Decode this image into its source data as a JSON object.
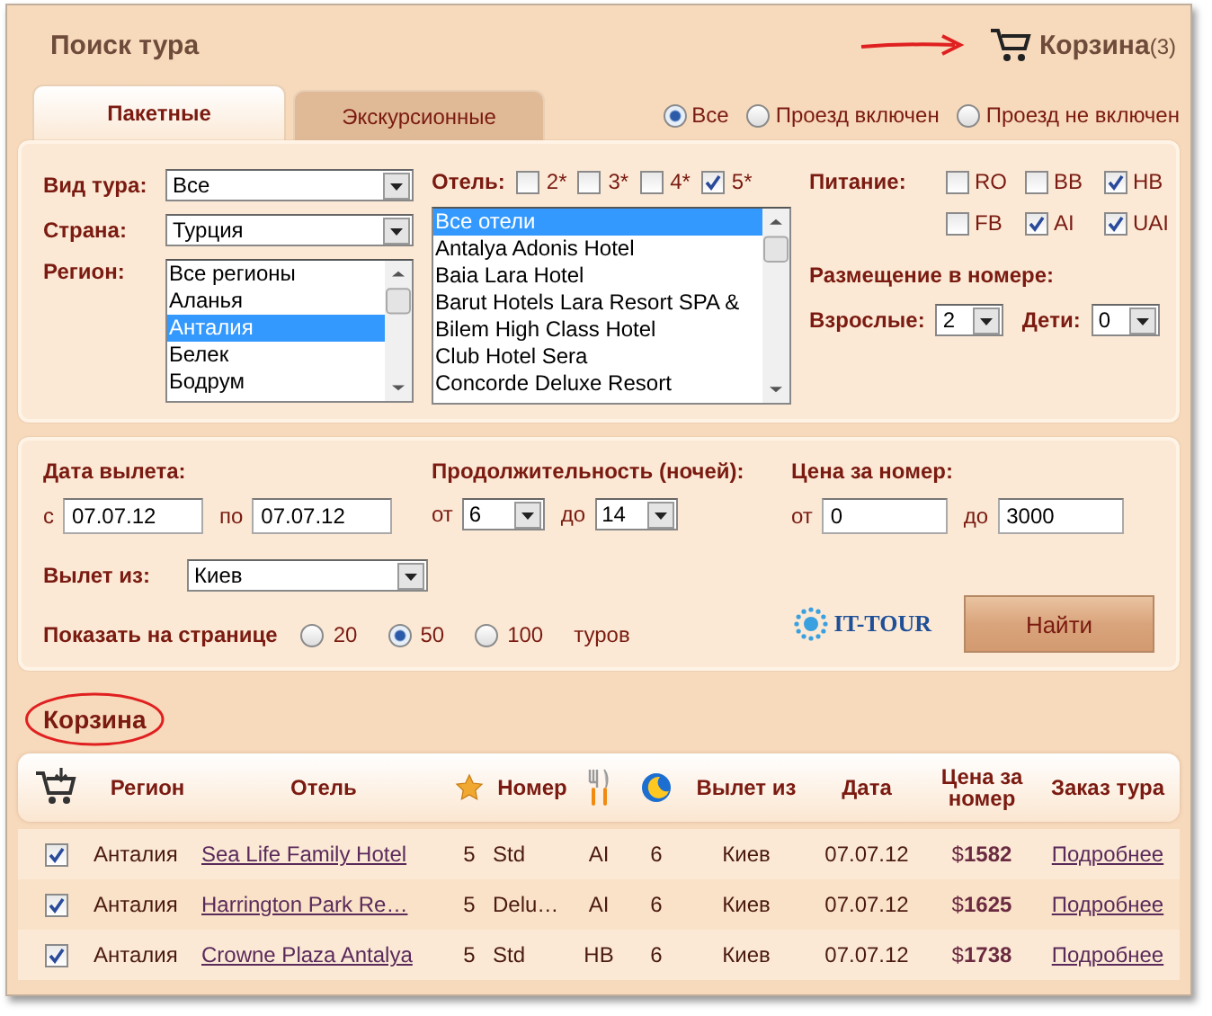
{
  "title": "Поиск тура",
  "cart": {
    "label": "Корзина",
    "count": "(3)"
  },
  "tabs": [
    {
      "label": "Пакетные",
      "selected": true
    },
    {
      "label": "Экскурсионные",
      "selected": false
    }
  ],
  "travel_filter": [
    {
      "label": "Все",
      "selected": true
    },
    {
      "label": "Проезд включен",
      "selected": false
    },
    {
      "label": "Проезд не включен",
      "selected": false
    }
  ],
  "tour_type": {
    "label": "Вид тура:",
    "value": "Все"
  },
  "country": {
    "label": "Страна:",
    "value": "Турция"
  },
  "region": {
    "label": "Регион:",
    "items": [
      {
        "label": "Все регионы",
        "selected": false
      },
      {
        "label": "Аланья",
        "selected": false
      },
      {
        "label": "Анталия",
        "selected": true
      },
      {
        "label": "Белек",
        "selected": false
      },
      {
        "label": "Бодрум",
        "selected": false
      }
    ]
  },
  "hotel": {
    "label": "Отель:",
    "stars": [
      {
        "label": "2*",
        "checked": false
      },
      {
        "label": "3*",
        "checked": false
      },
      {
        "label": "4*",
        "checked": false
      },
      {
        "label": "5*",
        "checked": true
      }
    ],
    "items": [
      {
        "label": "Все отели",
        "selected": true
      },
      {
        "label": "Antalya Adonis Hotel",
        "selected": false
      },
      {
        "label": "Baia Lara Hotel",
        "selected": false
      },
      {
        "label": "Barut Hotels Lara Resort SPA &",
        "selected": false
      },
      {
        "label": "Bilem High Class Hotel",
        "selected": false
      },
      {
        "label": "Club Hotel Sera",
        "selected": false
      },
      {
        "label": "Concorde Deluxe Resort",
        "selected": false
      }
    ]
  },
  "meal": {
    "label": "Питание:",
    "options": [
      {
        "label": "RO",
        "checked": false
      },
      {
        "label": "BB",
        "checked": false
      },
      {
        "label": "HB",
        "checked": true
      },
      {
        "label": "FB",
        "checked": false
      },
      {
        "label": "AI",
        "checked": true
      },
      {
        "label": "UAI",
        "checked": true
      }
    ]
  },
  "accommodation": {
    "label": "Размещение в номере:",
    "adults": {
      "label": "Взрослые:",
      "value": "2"
    },
    "children": {
      "label": "Дети:",
      "value": "0"
    }
  },
  "dates": {
    "label": "Дата вылета:",
    "from_label": "с",
    "from": "07.07.12",
    "to_label": "по",
    "to": "07.07.12"
  },
  "duration": {
    "label": "Продолжительность (ночей):",
    "from_label": "от",
    "from": "6",
    "to_label": "до",
    "to": "14"
  },
  "price": {
    "label": "Цена за номер:",
    "from_label": "от",
    "from": "0",
    "to_label": "до",
    "to": "3000"
  },
  "departure": {
    "label": "Вылет из:",
    "value": "Киев"
  },
  "per_page": {
    "label": "Показать на странице",
    "options": [
      {
        "label": "20",
        "selected": false
      },
      {
        "label": "50",
        "selected": true
      },
      {
        "label": "100",
        "selected": false
      }
    ],
    "suffix": "туров"
  },
  "logo": "IT-TOUR",
  "search_button": "Найти",
  "basket": {
    "heading": "Корзина",
    "columns": [
      {
        "kind": "cart"
      },
      {
        "kind": "text",
        "label": "Регион"
      },
      {
        "kind": "text",
        "label": "Отель"
      },
      {
        "kind": "star"
      },
      {
        "kind": "text",
        "label": "Номер"
      },
      {
        "kind": "meal"
      },
      {
        "kind": "nights"
      },
      {
        "kind": "text",
        "label": "Вылет из"
      },
      {
        "kind": "text",
        "label": "Дата"
      },
      {
        "kind": "text",
        "label": "Цена за номер"
      },
      {
        "kind": "text",
        "label": "Заказ тура"
      }
    ],
    "rows": [
      {
        "checked": true,
        "region": "Анталия",
        "hotel": "Sea Life Family Hotel",
        "stars": "5",
        "room": "Std",
        "meal": "AI",
        "nights": "6",
        "from": "Киев",
        "date": "07.07.12",
        "price": "$**1582**",
        "link": "Подробнее"
      },
      {
        "checked": true,
        "region": "Анталия",
        "hotel": "Harrington Park Re…",
        "stars": "5",
        "room": "Delu…",
        "meal": "AI",
        "nights": "6",
        "from": "Киев",
        "date": "07.07.12",
        "price": "$**1625**",
        "link": "Подробнее"
      },
      {
        "checked": true,
        "region": "Анталия",
        "hotel": "Crowne Plaza Antalya",
        "stars": "5",
        "room": "Std",
        "meal": "HB",
        "nights": "6",
        "from": "Киев",
        "date": "07.07.12",
        "price": "$**1738**",
        "link": "Подробнее"
      }
    ]
  }
}
